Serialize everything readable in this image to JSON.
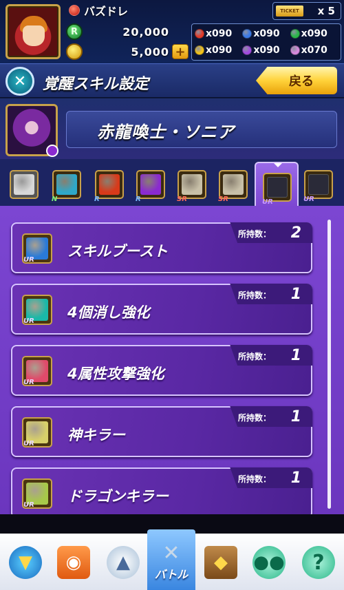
{
  "player": {
    "name": "バズドレ"
  },
  "currency": {
    "rune_value": "20,000",
    "coin_value": "5,000",
    "coin_plus": "+",
    "ticket_label": "TICKET",
    "ticket_count": "x 5"
  },
  "orbs": [
    {
      "color": "#e23b2a",
      "count": "x090"
    },
    {
      "color": "#3a7ae8",
      "count": "x090"
    },
    {
      "color": "#2ab84a",
      "count": "x090"
    },
    {
      "color": "#f2c21a",
      "count": "x090"
    },
    {
      "color": "#a24ae0",
      "count": "x090"
    },
    {
      "color": "#d88adf",
      "count": "x070"
    }
  ],
  "header": {
    "title": "覚醒スキル設定",
    "back_label": "戻る"
  },
  "character": {
    "name": "赤龍喚士・ソニア"
  },
  "slots": [
    {
      "rarity": "",
      "color": "#d8d8d8"
    },
    {
      "rarity": "N",
      "color": "#2fa8c8"
    },
    {
      "rarity": "R",
      "color": "#d83a1a"
    },
    {
      "rarity": "R",
      "color": "#8a2ad0"
    },
    {
      "rarity": "SR",
      "color": "#c8c0a8"
    },
    {
      "rarity": "SR",
      "color": "#c8c0a8"
    },
    {
      "rarity": "UR",
      "color": ""
    },
    {
      "rarity": "UR",
      "color": ""
    }
  ],
  "skill_list": {
    "owned_label": "所持数：",
    "items": [
      {
        "name": "スキルブースト",
        "count": "2",
        "rarity": "UR",
        "icon_color": "#2a7ad8"
      },
      {
        "name": "4個消し強化",
        "count": "1",
        "rarity": "UR",
        "icon_color": "#1ab8a8"
      },
      {
        "name": "4属性攻撃強化",
        "count": "1",
        "rarity": "UR",
        "icon_color": "#e04a6a"
      },
      {
        "name": "神キラー",
        "count": "1",
        "rarity": "UR",
        "icon_color": "#d8d06a"
      },
      {
        "name": "ドラゴンキラー",
        "count": "1",
        "rarity": "UR",
        "icon_color": "#a8c84a"
      }
    ]
  },
  "nav": {
    "active_label": "バトル",
    "items": [
      {
        "icon": "map-icon"
      },
      {
        "icon": "shop-icon"
      },
      {
        "icon": "monster-icon"
      },
      {
        "icon": "battle-icon"
      },
      {
        "icon": "book-icon"
      },
      {
        "icon": "friends-icon"
      },
      {
        "icon": "help-icon"
      }
    ]
  }
}
